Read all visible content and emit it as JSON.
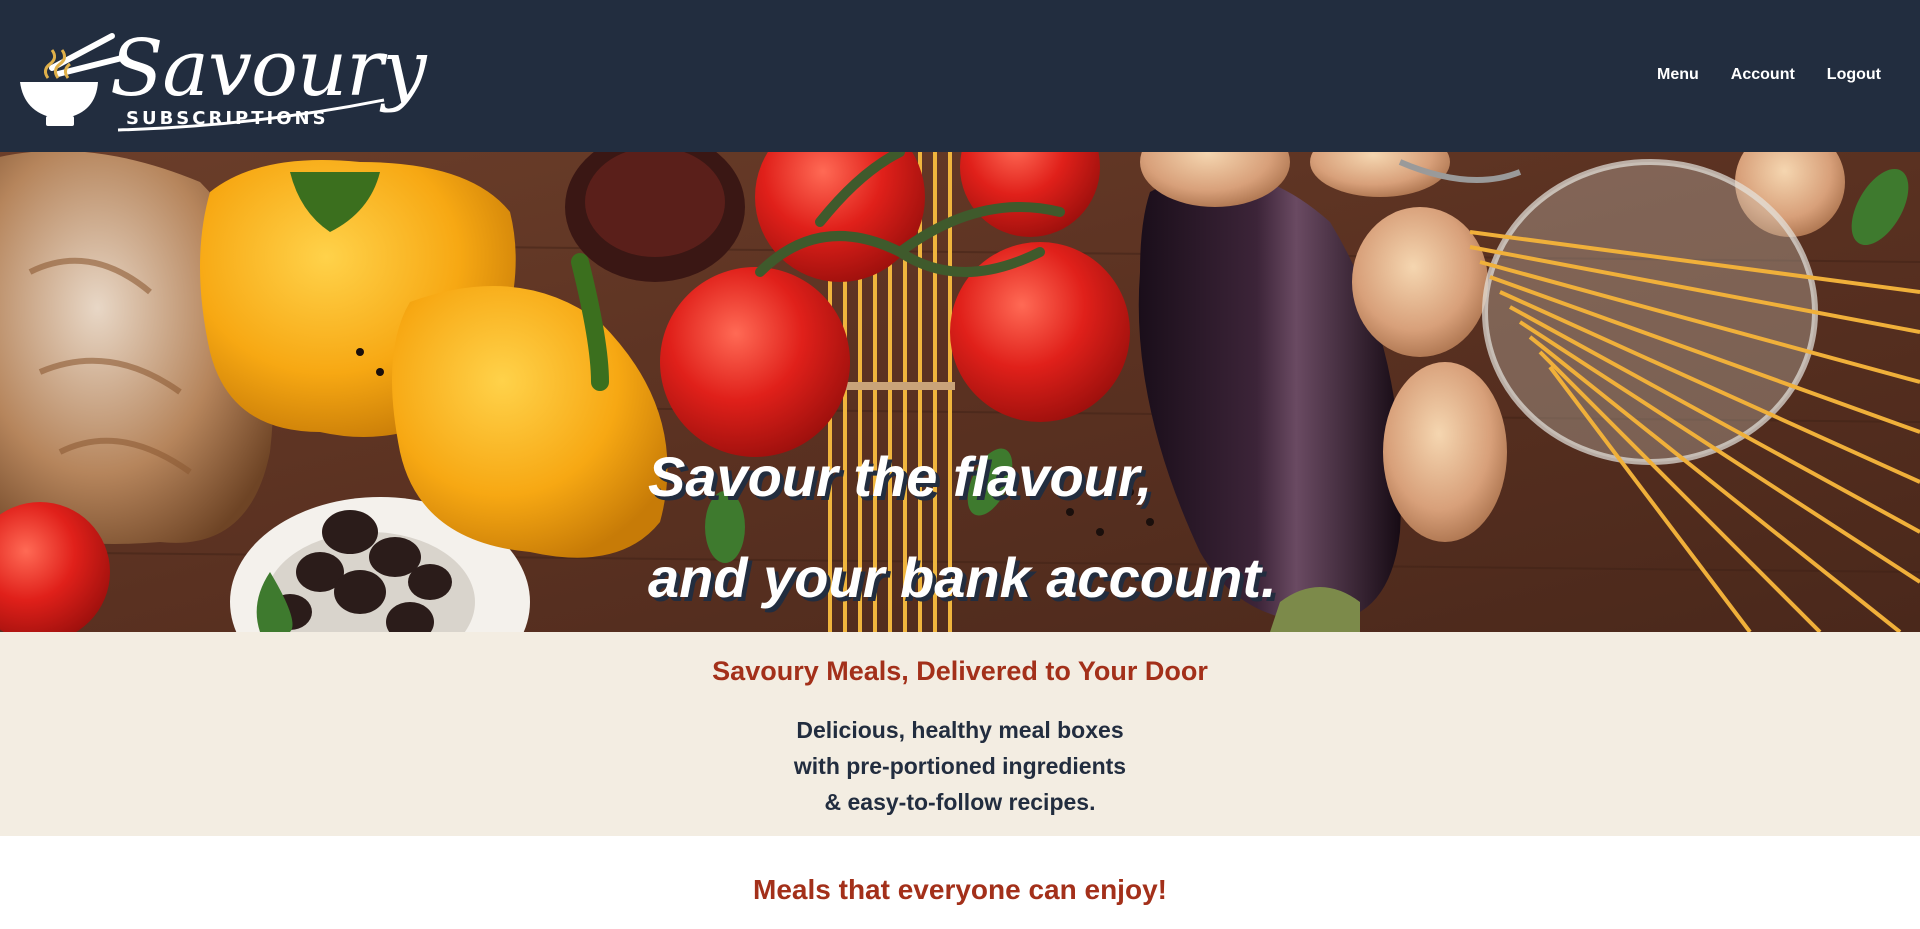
{
  "brand": {
    "name": "Savoury",
    "subtitle": "SUBSCRIPTIONS",
    "logo_icon": "noodle-bowl-icon"
  },
  "nav": {
    "items": [
      {
        "label": "Menu"
      },
      {
        "label": "Account"
      },
      {
        "label": "Logout"
      }
    ]
  },
  "hero": {
    "line1": "Savour the flavour,",
    "line2": "and your bank account.",
    "image": "vegetables-pasta-bread-on-wooden-table"
  },
  "intro": {
    "heading": "Savoury Meals, Delivered to Your Door",
    "lines": [
      "Delicious, healthy meal boxes",
      "with pre-portioned ingredients",
      "& easy-to-follow recipes."
    ]
  },
  "section2": {
    "heading": "Meals that everyone can enjoy!"
  },
  "colors": {
    "header_bg": "#222d3f",
    "accent_red": "#a3301a",
    "intro_bg": "#f3ede2",
    "text_dark": "#222d3f"
  }
}
